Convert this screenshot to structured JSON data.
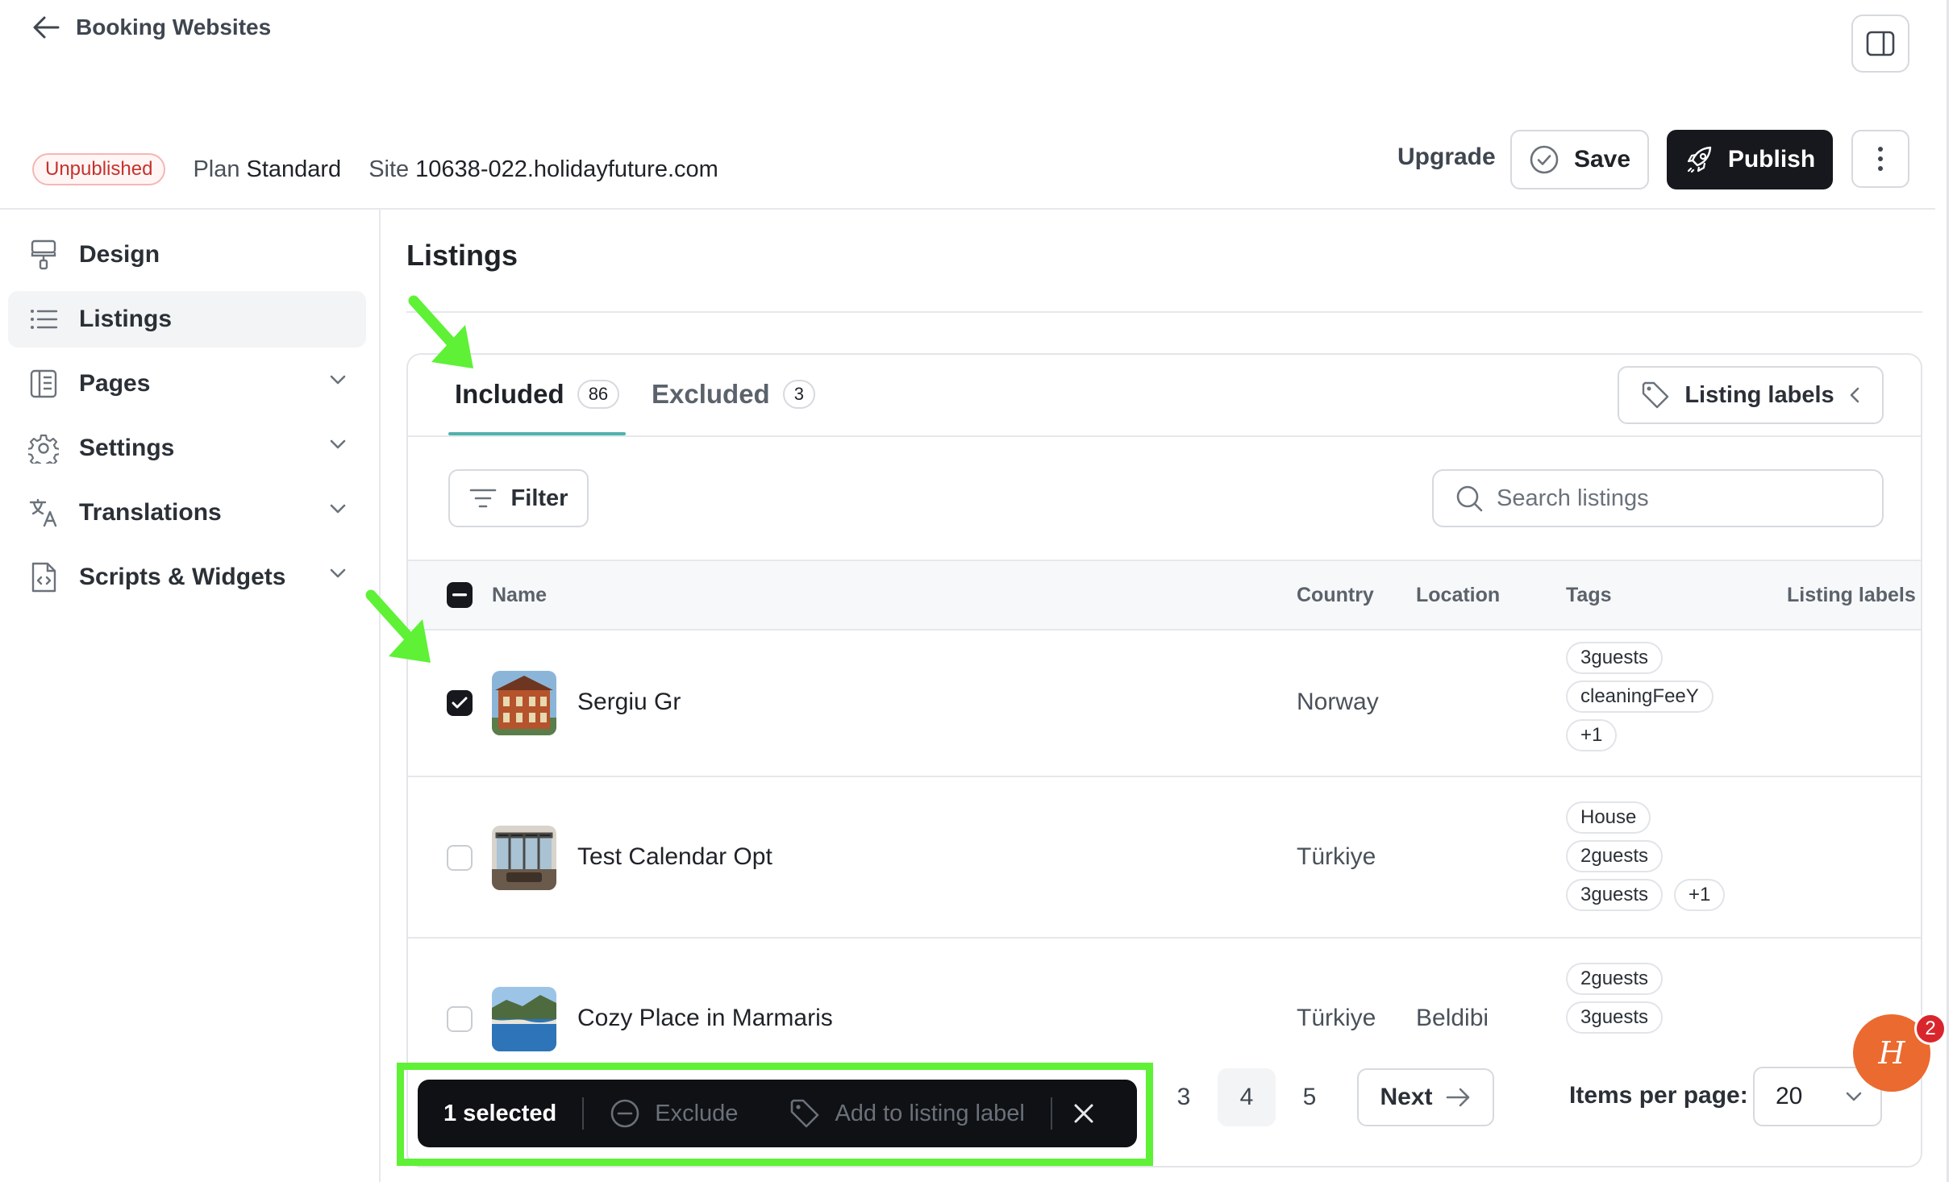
{
  "header": {
    "back_label": "Booking Websites",
    "status_badge": "Unpublished",
    "plan_label": "Plan",
    "plan_value": "Standard",
    "site_label": "Site",
    "site_value": "10638-022.holidayfuture.com",
    "upgrade_label": "Upgrade",
    "save_label": "Save",
    "publish_label": "Publish"
  },
  "sidebar": {
    "items": [
      {
        "label": "Design",
        "icon": "paint-roller-icon",
        "active": false
      },
      {
        "label": "Listings",
        "icon": "list-icon",
        "active": true
      },
      {
        "label": "Pages",
        "icon": "pages-icon",
        "active": false
      },
      {
        "label": "Settings",
        "icon": "gear-icon",
        "active": false
      },
      {
        "label": "Translations",
        "icon": "translate-icon",
        "active": false
      },
      {
        "label": "Scripts & Widgets",
        "icon": "code-file-icon",
        "active": false
      }
    ]
  },
  "main": {
    "title": "Listings",
    "tabs": [
      {
        "label": "Included",
        "count": "86",
        "active": true
      },
      {
        "label": "Excluded",
        "count": "3",
        "active": false
      }
    ],
    "listing_labels_button": "Listing labels",
    "filter_button": "Filter",
    "search_placeholder": "Search listings",
    "columns": [
      "Name",
      "Country",
      "Location",
      "Tags",
      "Listing labels"
    ],
    "rows": [
      {
        "name": "Sergiu Gr",
        "country": "Norway",
        "location": "",
        "checked": true,
        "tags": [
          "3guests",
          "cleaningFeeY",
          "+1"
        ]
      },
      {
        "name": "Test Calendar Opt",
        "country": "Türkiye",
        "location": "",
        "checked": false,
        "tags": [
          "House",
          "2guests",
          "3guests",
          "+1"
        ]
      },
      {
        "name": "Cozy Place in Marmaris",
        "country": "Türkiye",
        "location": "Beldibi",
        "checked": false,
        "tags": [
          "2guests",
          "3guests"
        ]
      }
    ]
  },
  "pagination": {
    "pages": [
      "3",
      "4",
      "5"
    ],
    "current": "4",
    "next_label": "Next",
    "items_per_page_label": "Items per page:",
    "items_per_page_value": "20"
  },
  "bulk_actions": {
    "selected_label": "1 selected",
    "exclude_label": "Exclude",
    "add_label": "Add to listing label"
  },
  "chat": {
    "badge_count": "2",
    "logo_letter": "H"
  },
  "colors": {
    "accent_tab": "#52b2ad",
    "primary_dark": "#16181d",
    "annotation_green": "#5ef135",
    "badge_red": "#c5322d",
    "chat_orange": "#eb6a30"
  }
}
